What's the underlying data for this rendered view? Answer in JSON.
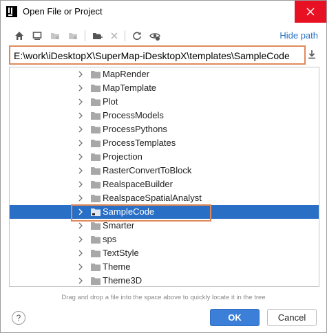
{
  "window": {
    "title": "Open File or Project",
    "app_icon": "intellij-idea-icon",
    "close_icon": "close-icon"
  },
  "toolbar": {
    "buttons": [
      {
        "icon": "home-icon",
        "enabled": true
      },
      {
        "icon": "desktop-icon",
        "enabled": true
      },
      {
        "icon": "project-folder-icon",
        "enabled": false
      },
      {
        "icon": "module-folder-icon",
        "enabled": false
      },
      {
        "icon": "new-folder-icon",
        "enabled": true
      },
      {
        "icon": "delete-icon",
        "enabled": false
      },
      {
        "icon": "refresh-icon",
        "enabled": true
      },
      {
        "icon": "show-hidden-icon",
        "enabled": true
      }
    ],
    "hide_path_label": "Hide path"
  },
  "path": {
    "value": "E:\\work\\iDesktopX\\SuperMap-iDesktopX\\templates\\SampleCode",
    "download_icon": "download-icon"
  },
  "tree": {
    "items": [
      {
        "label": "MapRender",
        "selected": false
      },
      {
        "label": "MapTemplate",
        "selected": false
      },
      {
        "label": "Plot",
        "selected": false
      },
      {
        "label": "ProcessModels",
        "selected": false
      },
      {
        "label": "ProcessPythons",
        "selected": false
      },
      {
        "label": "ProcessTemplates",
        "selected": false
      },
      {
        "label": "Projection",
        "selected": false
      },
      {
        "label": "RasterConvertToBlock",
        "selected": false
      },
      {
        "label": "RealspaceBuilder",
        "selected": false
      },
      {
        "label": "RealspaceSpatialAnalyst",
        "selected": false
      },
      {
        "label": "SampleCode",
        "selected": true
      },
      {
        "label": "Smarter",
        "selected": false
      },
      {
        "label": "sps",
        "selected": false
      },
      {
        "label": "TextStyle",
        "selected": false
      },
      {
        "label": "Theme",
        "selected": false
      },
      {
        "label": "Theme3D",
        "selected": false
      }
    ]
  },
  "hint": "Drag and drop a file into the space above to quickly locate it in the tree",
  "footer": {
    "help_label": "?",
    "ok_label": "OK",
    "cancel_label": "Cancel"
  },
  "colors": {
    "selection": "#2a6fc6",
    "highlight_border": "#e08a5b",
    "link": "#2470c7",
    "ok_button": "#3b7fd9",
    "close_button": "#e81123"
  }
}
